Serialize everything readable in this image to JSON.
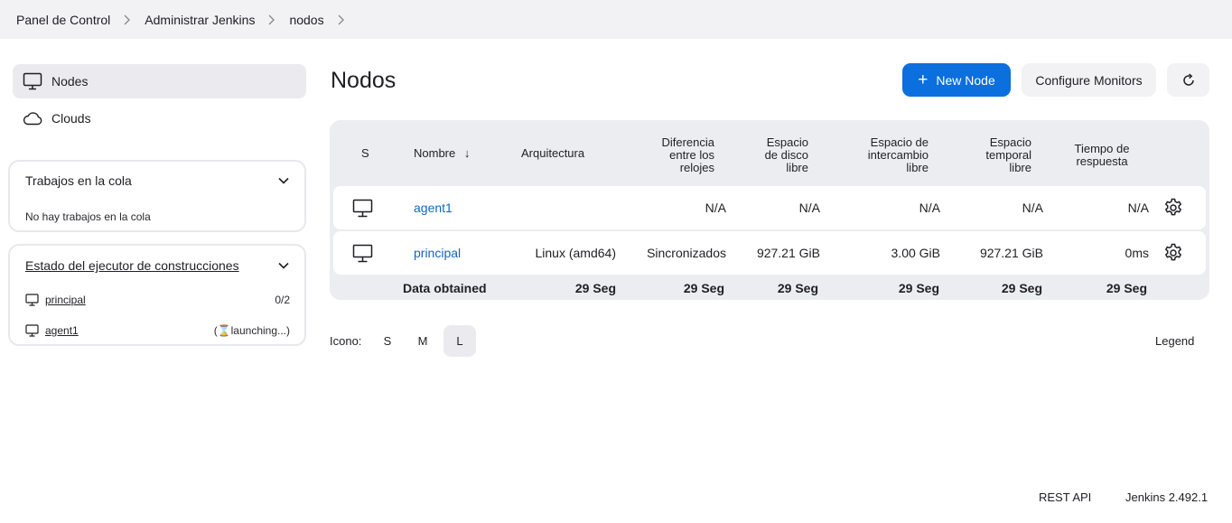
{
  "breadcrumb": {
    "items": [
      "Panel de Control",
      "Administrar Jenkins",
      "nodos"
    ]
  },
  "sidebar": {
    "items": [
      {
        "label": "Nodes",
        "icon": "computer-icon",
        "active": true
      },
      {
        "label": "Clouds",
        "icon": "cloud-icon",
        "active": false
      }
    ],
    "queue": {
      "title": "Trabajos en la cola",
      "empty_text": "No hay trabajos en la cola"
    },
    "executors": {
      "title": "Estado del ejecutor de construcciones",
      "rows": [
        {
          "name": "principal",
          "status": "0/2"
        },
        {
          "name": "agent1",
          "status": "(⌛launching...)"
        }
      ]
    }
  },
  "main": {
    "title": "Nodos",
    "new_node_label": "New Node",
    "configure_monitors_label": "Configure Monitors",
    "table": {
      "headers": {
        "s": "S",
        "name": "Nombre",
        "sort_indicator": "↓",
        "arch": "Arquitectura",
        "clock_lines": [
          "Diferencia",
          "entre los",
          "relojes"
        ],
        "disk_lines": [
          "Espacio",
          "de disco",
          "libre"
        ],
        "swap_lines": [
          "Espacio de",
          "intercambio",
          "libre"
        ],
        "temp_lines": [
          "Espacio",
          "temporal",
          "libre"
        ],
        "resp_lines": [
          "Tiempo de",
          "respuesta"
        ]
      },
      "rows": [
        {
          "name": "agent1",
          "arch": "",
          "clock": "N/A",
          "disk": "N/A",
          "swap": "N/A",
          "temp": "N/A",
          "resp": "N/A"
        },
        {
          "name": "principal",
          "arch": "Linux (amd64)",
          "clock": "Sincronizados",
          "disk": "927.21 GiB",
          "swap": "3.00 GiB",
          "temp": "927.21 GiB",
          "resp": "0ms"
        }
      ],
      "footer": {
        "label": "Data obtained",
        "arch": "29 Seg",
        "clock": "29 Seg",
        "disk": "29 Seg",
        "swap": "29 Seg",
        "temp": "29 Seg",
        "resp": "29 Seg"
      }
    },
    "icon_size": {
      "label": "Icono:",
      "options": [
        "S",
        "M",
        "L"
      ],
      "selected": "L"
    },
    "legend_label": "Legend"
  },
  "footer": {
    "rest_api": "REST API",
    "version": "Jenkins 2.492.1"
  },
  "colors": {
    "primary": "#0b6fdd",
    "link": "#1565c0",
    "background_alt": "#f2f2f4"
  }
}
